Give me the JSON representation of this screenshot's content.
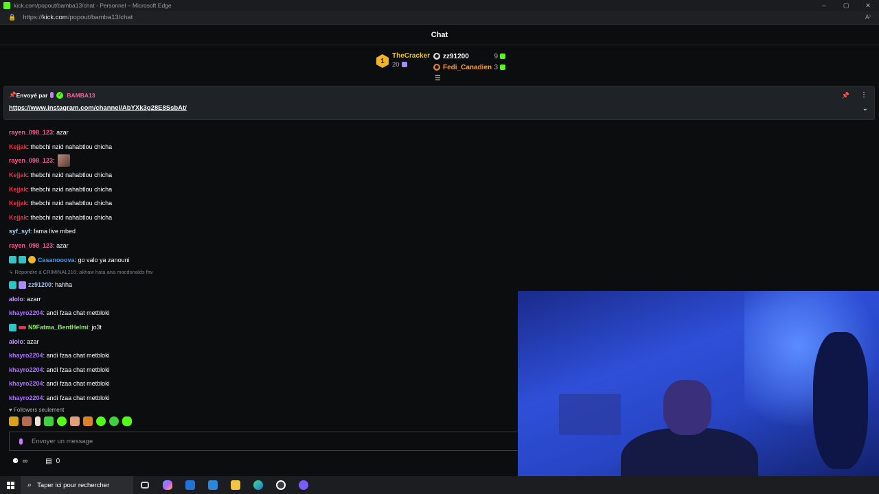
{
  "window": {
    "title": "kick.com/popout/bamba13/chat - Personnel – Microsoft Edge",
    "controls": [
      "–",
      "▢",
      "✕"
    ]
  },
  "address_bar": {
    "prefix": "https://",
    "host": "kick.com",
    "path": "/popout/bamba13/chat"
  },
  "header": {
    "title": "Chat"
  },
  "leaderboard": {
    "first": {
      "rank": "1",
      "name": "TheCracker",
      "count": "20"
    },
    "others": [
      {
        "name": "zz91200",
        "count": "9"
      },
      {
        "name": "Fedi_Canadien",
        "count": "3"
      }
    ]
  },
  "pinned": {
    "prefix": "Envoyé par",
    "sender": "BAMBA13",
    "link": "https://www.instagram.com/channel/AbYXk3g28E8SsbAt/"
  },
  "messages": [
    {
      "user": "rayen_098_123",
      "color": "#ff5d8f",
      "text": ": azar"
    },
    {
      "user": "Kejjak",
      "color": "#e8304b",
      "text": ": thebchi nzid nahabtlou chicha"
    },
    {
      "user": "rayen_098_123",
      "color": "#ff5d8f",
      "text": ":",
      "emote": true
    },
    {
      "user": "Kejjak",
      "color": "#e8304b",
      "text": ": thebchi nzid nahabtlou chicha"
    },
    {
      "user": "Kejjak",
      "color": "#e8304b",
      "text": ": thebchi nzid nahabtlou chicha"
    },
    {
      "user": "Kejjak",
      "color": "#e8304b",
      "text": ": thebchi nzid nahabtlou chicha"
    },
    {
      "user": "Kejjak",
      "color": "#e8304b",
      "text": ": thebchi nzid nahabtlou chicha"
    },
    {
      "user": "syf_syf",
      "color": "#a7d8ff",
      "text": ": fama live mbed"
    },
    {
      "user": "rayen_098_123",
      "color": "#ff5d8f",
      "text": ": azar"
    },
    {
      "user": "Casanooova",
      "color": "#3d9bff",
      "text": ": go valo ya zanouni",
      "badges": [
        "teal",
        "teal",
        "gold"
      ]
    }
  ],
  "reply": {
    "text": "Répondre à CRIMINAL216: akhaw hata ana macdonalds ftw"
  },
  "messages2": [
    {
      "user": "zz91200",
      "color": "#93c5fd",
      "text": ": hahha",
      "badges": [
        "teal",
        "lav"
      ]
    },
    {
      "user": "alolo",
      "color": "#c799ff",
      "text": ": azarr"
    },
    {
      "user": "khayro2204",
      "color": "#b072ff",
      "text": ": andi fzaa chat metbloki"
    },
    {
      "user": "N9Fatma_BentHelmi",
      "color": "#86ef5a",
      "text": ": jo3t",
      "badges": [
        "teal",
        "red"
      ]
    },
    {
      "user": "alolo",
      "color": "#c799ff",
      "text": ": azar"
    },
    {
      "user": "khayro2204",
      "color": "#b072ff",
      "text": ": andi fzaa chat metbloki"
    },
    {
      "user": "khayro2204",
      "color": "#b072ff",
      "text": ": andi fzaa chat metbloki"
    },
    {
      "user": "khayro2204",
      "color": "#b072ff",
      "text": ": andi fzaa chat metbloki"
    },
    {
      "user": "khayro2204",
      "color": "#b072ff",
      "text": ": andi fzaa chat metbloki"
    }
  ],
  "followers_only": "Followers seulement",
  "input": {
    "placeholder": "Envoyer un message"
  },
  "tools": {
    "infinity": "∞",
    "count": "0"
  },
  "taskbar": {
    "search_placeholder": "Taper ici pour rechercher",
    "apps": [
      "task-view",
      "copilot",
      "mail",
      "store",
      "explorer",
      "edge",
      "obs",
      "discord"
    ]
  }
}
